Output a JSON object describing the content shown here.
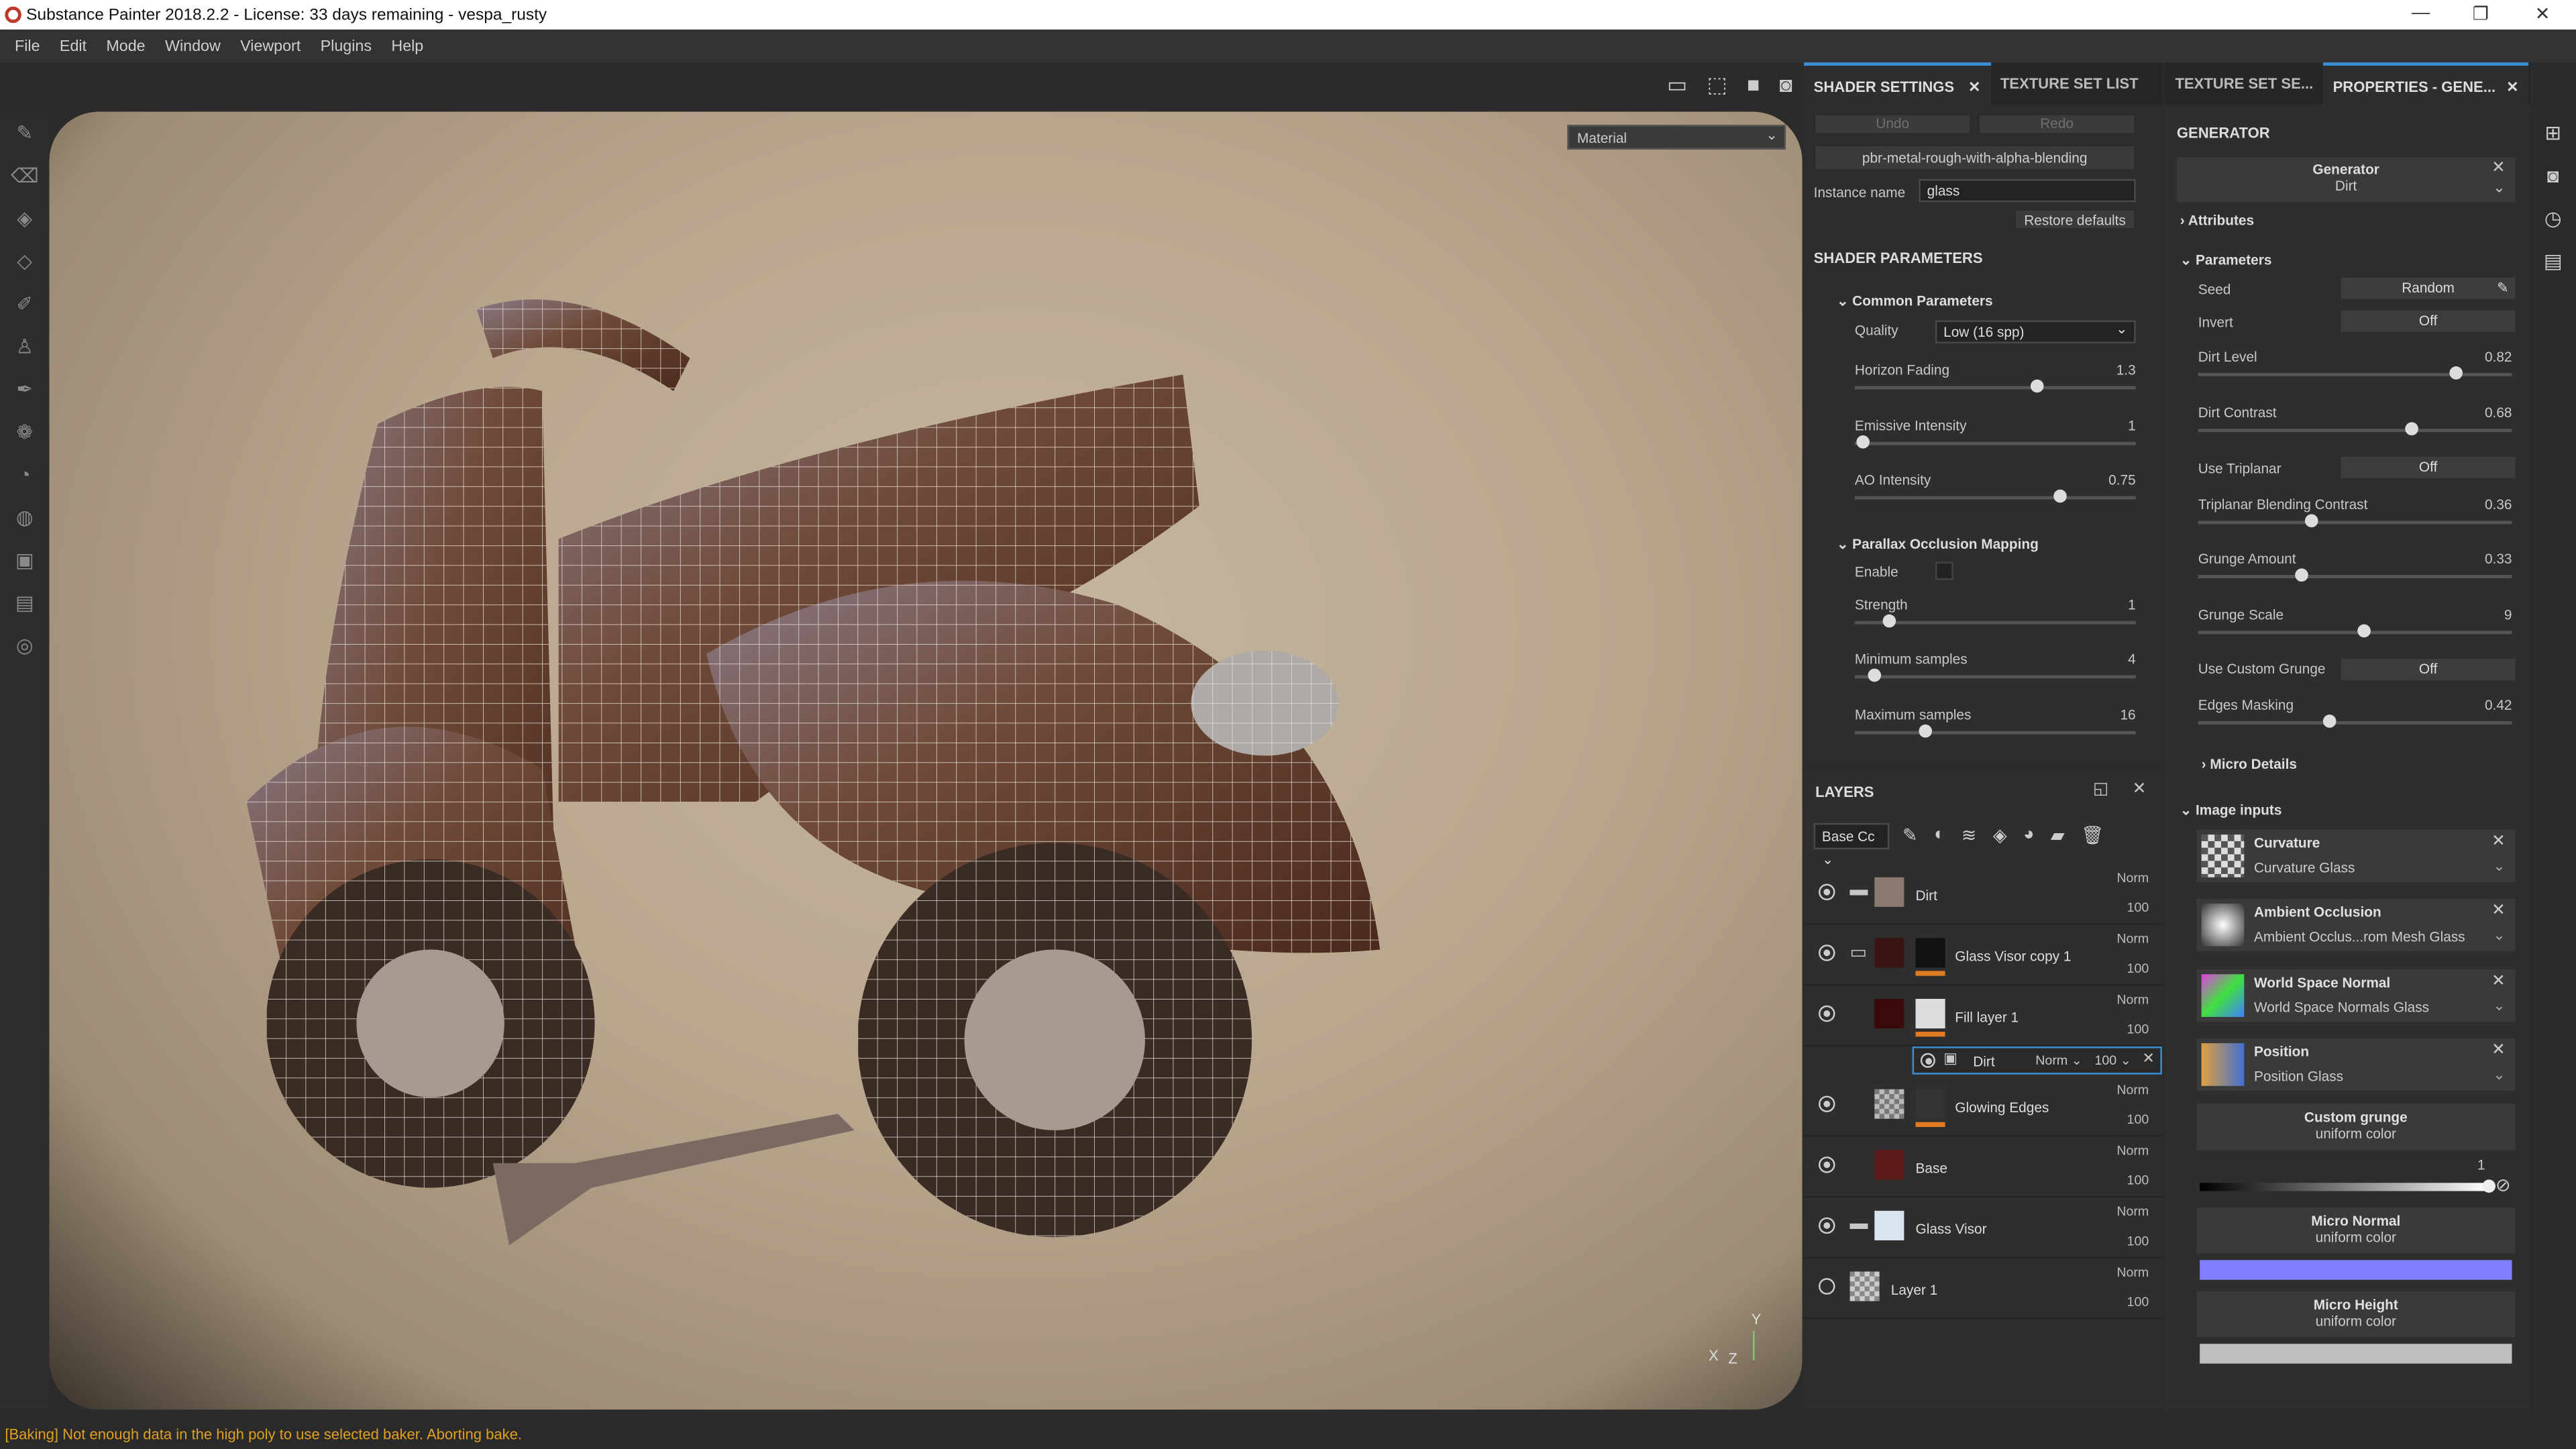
{
  "window": {
    "title": "Substance Painter 2018.2.2 - License: 33 days remaining - vespa_rusty"
  },
  "menu": [
    "File",
    "Edit",
    "Mode",
    "Window",
    "Viewport",
    "Plugins",
    "Help"
  ],
  "viewport": {
    "material_select": "Material",
    "axis_x": "X",
    "axis_z": "Z",
    "axis_y": "Y"
  },
  "shader_panel": {
    "tabs": [
      "SHADER SETTINGS",
      "TEXTURE SET LIST"
    ],
    "undo": "Undo",
    "redo": "Redo",
    "shader_name": "pbr-metal-rough-with-alpha-blending",
    "instance_label": "Instance name",
    "instance_value": "glass",
    "restore": "Restore defaults",
    "params_title": "SHADER PARAMETERS",
    "common_title": "Common Parameters",
    "quality_label": "Quality",
    "quality_value": "Low (16 spp)",
    "sliders": [
      {
        "label": "Horizon Fading",
        "value": "1.3",
        "pct": 0.65
      },
      {
        "label": "Emissive Intensity",
        "value": "1",
        "pct": 0.03
      },
      {
        "label": "AO Intensity",
        "value": "0.75",
        "pct": 0.73
      }
    ],
    "pom_title": "Parallax Occlusion Mapping",
    "enable_label": "Enable",
    "pom_sliders": [
      {
        "label": "Strength",
        "value": "1",
        "pct": 0.12
      },
      {
        "label": "Minimum samples",
        "value": "4",
        "pct": 0.07
      },
      {
        "label": "Maximum samples",
        "value": "16",
        "pct": 0.25
      }
    ]
  },
  "layers": {
    "title": "LAYERS",
    "channel": "Base Cc",
    "rows": [
      {
        "name": "Dirt",
        "blend": "Norm",
        "opacity": "100",
        "visible": true
      },
      {
        "name": "Glass Visor copy 1",
        "blend": "Norm",
        "opacity": "100",
        "visible": true
      },
      {
        "name": "Fill layer 1",
        "blend": "Norm",
        "opacity": "100",
        "visible": true
      },
      {
        "name": "Glowing Edges",
        "blend": "Norm",
        "opacity": "100",
        "visible": true
      },
      {
        "name": "Base",
        "blend": "Norm",
        "opacity": "100",
        "visible": true
      },
      {
        "name": "Glass Visor",
        "blend": "Norm",
        "opacity": "100",
        "visible": true
      },
      {
        "name": "Layer 1",
        "blend": "Norm",
        "opacity": "100",
        "visible": false
      }
    ],
    "mask": {
      "name": "Dirt",
      "blend": "Norm",
      "opacity": "100"
    }
  },
  "properties_panel": {
    "tabs": [
      "TEXTURE SET SE...",
      "PROPERTIES - GENE..."
    ],
    "title": "GENERATOR",
    "generator_label": "Generator",
    "generator_value": "Dirt",
    "attributes": "Attributes",
    "parameters": "Parameters",
    "seed_label": "Seed",
    "seed_value": "Random",
    "invert_label": "Invert",
    "invert_value": "Off",
    "dirt_level": {
      "label": "Dirt Level",
      "value": "0.82",
      "pct": 0.82
    },
    "dirt_contrast": {
      "label": "Dirt Contrast",
      "value": "0.68",
      "pct": 0.68
    },
    "triplanar_label": "Use Triplanar",
    "triplanar_value": "Off",
    "tri_blend": {
      "label": "Triplanar Blending Contrast",
      "value": "0.36",
      "pct": 0.36
    },
    "grunge_amount": {
      "label": "Grunge Amount",
      "value": "0.33",
      "pct": 0.33
    },
    "grunge_scale": {
      "label": "Grunge Scale",
      "value": "9",
      "pct": 0.53
    },
    "custom_grunge_label": "Use Custom Grunge",
    "custom_grunge_value": "Off",
    "edges_masking": {
      "label": "Edges Masking",
      "value": "0.42",
      "pct": 0.42
    },
    "micro_details": "Micro Details",
    "image_inputs": "Image inputs",
    "inputs": [
      {
        "name": "Curvature",
        "source": "Curvature Glass"
      },
      {
        "name": "Ambient Occlusion",
        "source": "Ambient Occlus...rom Mesh Glass"
      },
      {
        "name": "World Space Normal",
        "source": "World Space Normals Glass"
      },
      {
        "name": "Position",
        "source": "Position Glass"
      }
    ],
    "custom_grunge": {
      "title": "Custom grunge",
      "sub": "uniform color",
      "value": "1"
    },
    "micro_normal": {
      "title": "Micro Normal",
      "sub": "uniform color",
      "color": "#8080ff"
    },
    "micro_height": {
      "title": "Micro Height",
      "sub": "uniform color",
      "color": "#bfbfbf"
    }
  },
  "status": "[Baking] Not enough data in the high poly to use selected baker. Aborting bake."
}
